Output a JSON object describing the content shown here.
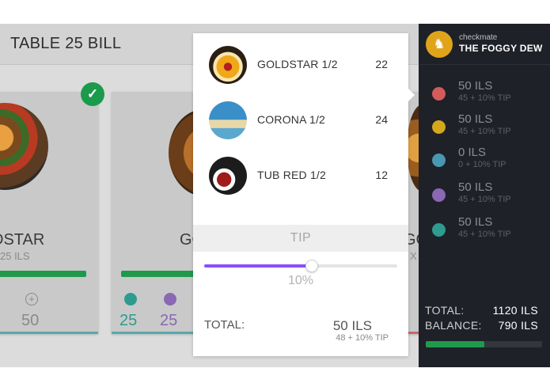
{
  "header": {
    "title": "TABLE 25 BILL"
  },
  "cards": [
    {
      "name": "DSTAR",
      "price": "25 ILS",
      "count": "50"
    },
    {
      "name": "GO",
      "shares": [
        "25",
        "25"
      ]
    },
    {
      "name": "GC",
      "price": "X"
    }
  ],
  "popup": {
    "items": [
      {
        "name": "GOLDSTAR 1/2",
        "qty": "22",
        "thumb": "goldstar-beer-thumb"
      },
      {
        "name": "CORONA 1/2",
        "qty": "24",
        "thumb": "corona-beer-thumb"
      },
      {
        "name": "TUB RED 1/2",
        "qty": "12",
        "thumb": "tub-red-beer-thumb"
      }
    ],
    "tip": {
      "label": "TIP",
      "percent": 10,
      "value_text": "10%"
    },
    "total": {
      "label": "TOTAL:",
      "amount": "50 ILS",
      "sub": "48 + 10% TIP"
    }
  },
  "sidebar": {
    "brand_small": "checkmate",
    "brand_name": "THE FOGGY DEW",
    "diners": [
      {
        "amount": "50 ILS",
        "sub": "45 + 10% TIP",
        "color": "#d35b5b"
      },
      {
        "amount": "50 ILS",
        "sub": "45 + 10% TIP",
        "color": "#d4a81c"
      },
      {
        "amount": "0 ILS",
        "sub": "0 + 10% TIP",
        "color": "#4a97b3"
      },
      {
        "amount": "50 ILS",
        "sub": "45 + 10% TIP",
        "color": "#8a68b4"
      },
      {
        "amount": "50 ILS",
        "sub": "45 + 10% TIP",
        "color": "#2e9b8e"
      }
    ],
    "total_label": "TOTAL:",
    "total_value": "1120 ILS",
    "balance_label": "BALANCE:",
    "balance_value": "790 ILS",
    "paid_fraction": 0.5
  },
  "colors": {
    "accent_green": "#1f9a4d",
    "slider_purple": "#8a4dff",
    "brand_gold": "#e0a41a",
    "sidebar_bg": "#1f2128"
  }
}
